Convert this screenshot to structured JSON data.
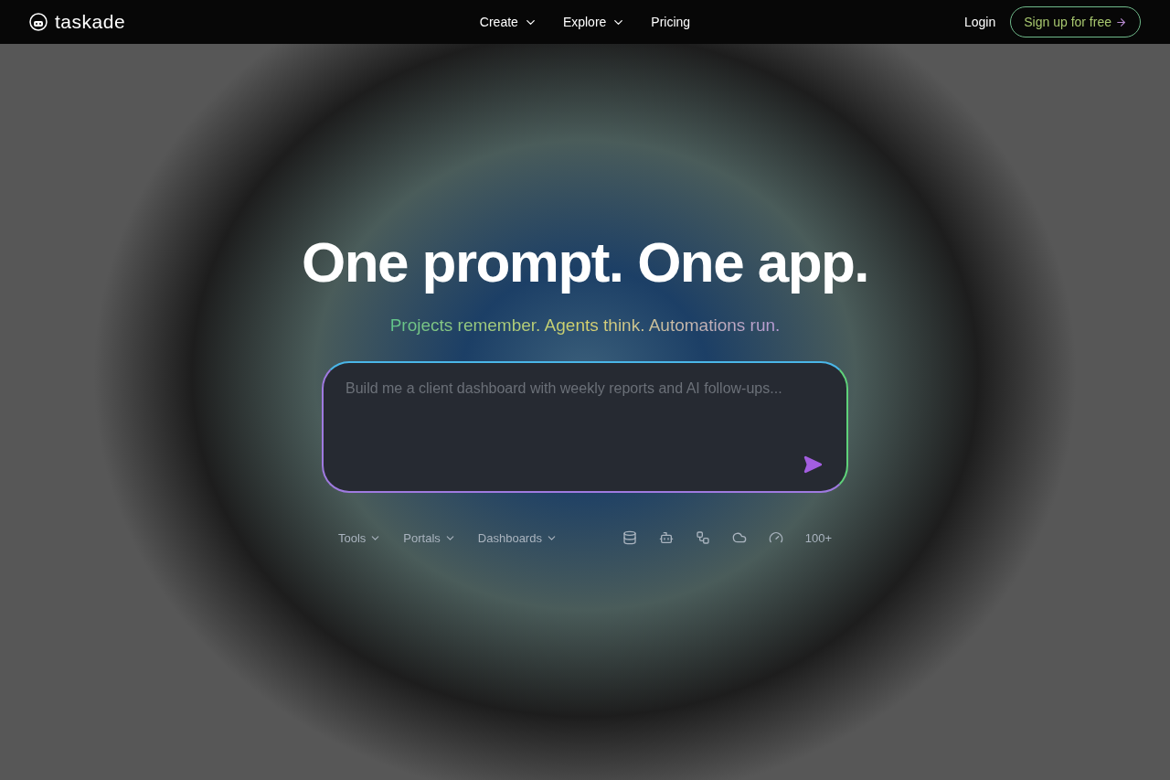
{
  "header": {
    "logo": "taskade",
    "nav": [
      {
        "label": "Create",
        "dropdown": true
      },
      {
        "label": "Explore",
        "dropdown": true
      },
      {
        "label": "Pricing",
        "dropdown": false
      }
    ],
    "login": "Login",
    "signup": "Sign up for free"
  },
  "hero": {
    "title": "One prompt. One app.",
    "subtitle": "Projects remember. Agents think. Automations run.",
    "prompt": {
      "placeholder": "Build me a client dashboard with weekly reports and AI follow-ups..."
    }
  },
  "categories": [
    {
      "label": "Tools"
    },
    {
      "label": "Portals"
    },
    {
      "label": "Dashboards"
    }
  ],
  "integrations": {
    "count": "100+"
  }
}
